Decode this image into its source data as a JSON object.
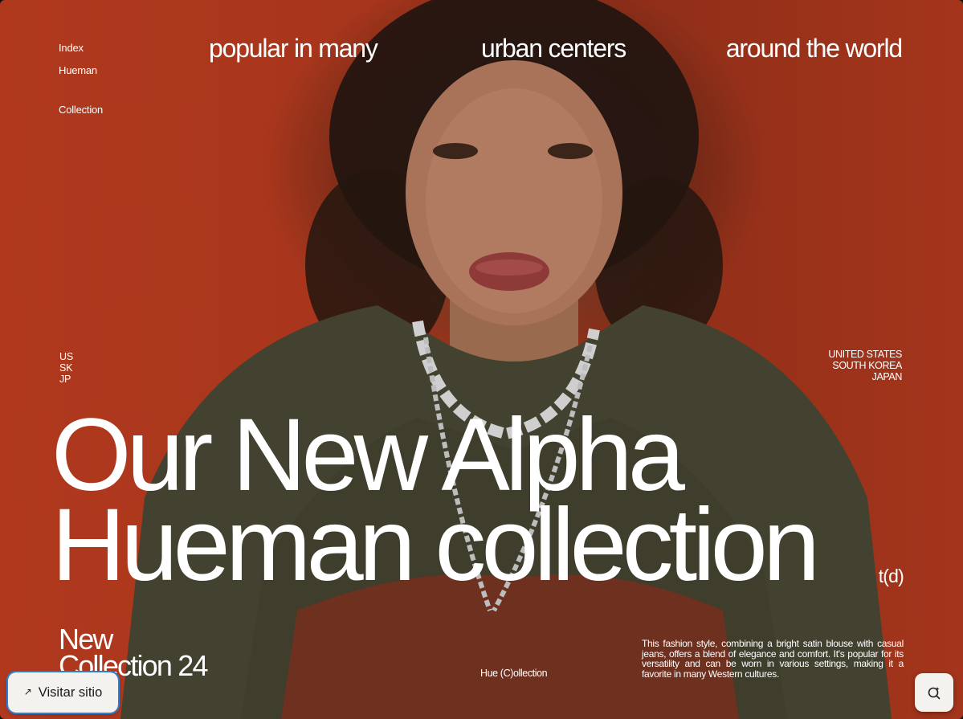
{
  "nav": {
    "items": [
      {
        "label": "Index"
      },
      {
        "label": "Hueman"
      },
      {
        "label": "Collection"
      }
    ]
  },
  "tagline": {
    "part1": "popular in many",
    "part2": "urban centers",
    "part3": "around the world"
  },
  "countries": {
    "codes": [
      "US",
      "SK",
      "JP"
    ],
    "names": [
      "UNITED STATES",
      "SOUTH KOREA",
      "JAPAN"
    ]
  },
  "headline": {
    "line1": "Our New Alpha",
    "line2": "Hueman collection"
  },
  "badge": "t(d)",
  "subtitle": {
    "line1": "New",
    "line2": "Collection 24"
  },
  "footer_label": "Hue (C)ollection",
  "description": "This fashion style, combining a bright satin blouse with casual jeans, offers a blend of elegance and comfort. It's popular for its versatility and can be worn in various settings, making it a favorite in many Western cultures.",
  "visit_button": {
    "label": "Visitar sitio",
    "icon": "external-link-arrow-icon"
  },
  "corner_button": {
    "icon": "lens-sparkle-icon"
  },
  "colors": {
    "background_red": "#a8361c",
    "sweater_olive": "#434230",
    "button_bg": "#f4f2ef",
    "focus_outline": "#2a7fd4"
  }
}
